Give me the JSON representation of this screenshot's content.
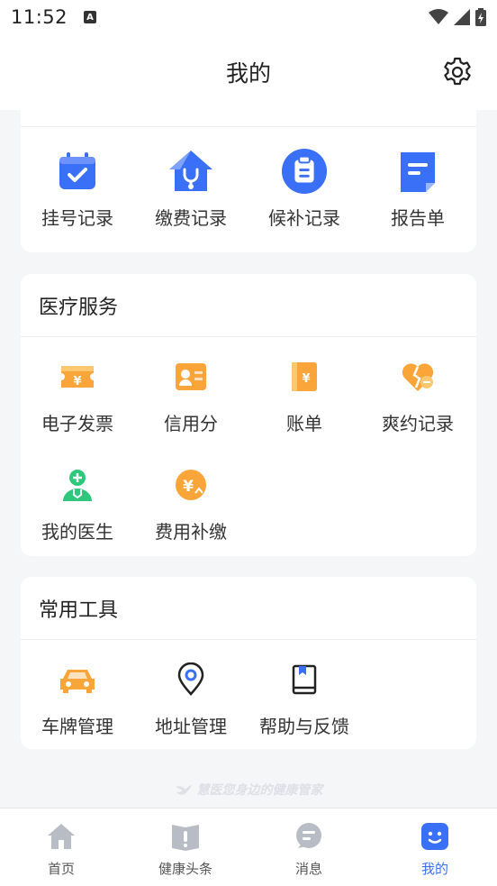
{
  "status_bar": {
    "time": "11:52",
    "a_icon": "A"
  },
  "header": {
    "title": "我的"
  },
  "record_section": {
    "items": [
      {
        "label": "挂号记录",
        "icon": "calendar-check-icon"
      },
      {
        "label": "缴费记录",
        "icon": "house-stethoscope-icon"
      },
      {
        "label": "候补记录",
        "icon": "clipboard-icon"
      },
      {
        "label": "报告单",
        "icon": "document-icon"
      }
    ]
  },
  "medical_services": {
    "title": "医疗服务",
    "items": [
      {
        "label": "电子发票",
        "icon": "yen-ticket-icon"
      },
      {
        "label": "信用分",
        "icon": "id-card-icon"
      },
      {
        "label": "账单",
        "icon": "yen-bill-icon"
      },
      {
        "label": "爽约记录",
        "icon": "broken-heart-icon"
      },
      {
        "label": "我的医生",
        "icon": "doctor-icon"
      },
      {
        "label": "费用补缴",
        "icon": "yen-coin-icon"
      }
    ]
  },
  "common_tools": {
    "title": "常用工具",
    "items": [
      {
        "label": "车牌管理",
        "icon": "car-icon"
      },
      {
        "label": "地址管理",
        "icon": "location-pin-icon"
      },
      {
        "label": "帮助与反馈",
        "icon": "book-icon"
      }
    ]
  },
  "slogan": "慧医您身边的健康管家",
  "tabbar": {
    "tabs": [
      {
        "label": "首页",
        "icon": "home-icon"
      },
      {
        "label": "健康头条",
        "icon": "news-book-icon"
      },
      {
        "label": "消息",
        "icon": "message-icon"
      },
      {
        "label": "我的",
        "icon": "face-icon",
        "active": true
      }
    ]
  },
  "colors": {
    "accent": "#3a6ff7",
    "orange": "#f9a53a",
    "green": "#2ec87d"
  }
}
